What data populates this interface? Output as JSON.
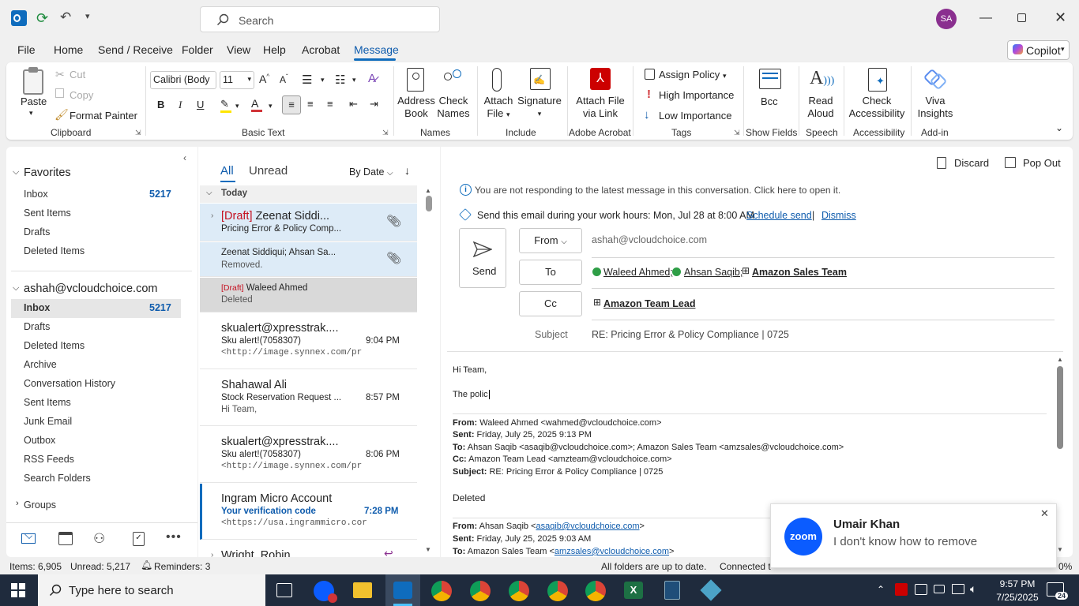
{
  "titlebar": {
    "search_placeholder": "Search",
    "avatar": "SA"
  },
  "menu": [
    "File",
    "Home",
    "Send / Receive",
    "Folder",
    "View",
    "Help",
    "Acrobat",
    "Message"
  ],
  "copilot": "Copilot",
  "ribbon": {
    "paste": "Paste",
    "cut": "Cut",
    "copy": "Copy",
    "format_painter": "Format Painter",
    "clipboard": "Clipboard",
    "font_name": "Calibri (Body",
    "font_size": "11",
    "basic_text": "Basic Text",
    "address_book": [
      "Address",
      "Book"
    ],
    "check_names": [
      "Check",
      "Names"
    ],
    "names": "Names",
    "attach_file": [
      "Attach",
      "File"
    ],
    "signature": "Signature",
    "include": "Include",
    "attach_link": [
      "Attach File",
      "via Link"
    ],
    "adobe": "Adobe Acrobat",
    "assign_policy": "Assign Policy",
    "high_importance": "High Importance",
    "low_importance": "Low Importance",
    "tags": "Tags",
    "bcc": "Bcc",
    "show_fields": "Show Fields",
    "read_aloud": [
      "Read",
      "Aloud"
    ],
    "speech": "Speech",
    "check_accessibility": [
      "Check",
      "Accessibility"
    ],
    "accessibility": "Accessibility",
    "viva": [
      "Viva",
      "Insights"
    ],
    "addin": "Add-in"
  },
  "folders": {
    "favorites": "Favorites",
    "fav_items": [
      {
        "label": "Inbox",
        "count": "5217"
      },
      {
        "label": "Sent Items"
      },
      {
        "label": "Drafts"
      },
      {
        "label": "Deleted Items"
      }
    ],
    "account": "ashah@vcloudchoice.com",
    "acct_items": [
      {
        "label": "Inbox",
        "count": "5217"
      },
      {
        "label": "Drafts"
      },
      {
        "label": "Deleted Items"
      },
      {
        "label": "Archive"
      },
      {
        "label": "Conversation History"
      },
      {
        "label": "Sent Items"
      },
      {
        "label": "Junk Email"
      },
      {
        "label": "Outbox"
      },
      {
        "label": "RSS Feeds"
      },
      {
        "label": "Search Folders"
      }
    ],
    "groups": "Groups"
  },
  "list": {
    "tab_all": "All",
    "tab_unread": "Unread",
    "sort": "By Date",
    "today": "Today",
    "draft_tag": "[Draft]",
    "items": [
      {
        "from": "Zeenat Siddi...",
        "subject": "Pricing Error & Policy Comp..."
      },
      {
        "from": "Zeenat Siddiqui;  Ahsan Sa...",
        "subject": "Removed."
      },
      {
        "from": "Waleed Ahmed",
        "subject": "Deleted"
      },
      {
        "from": "skualert@xpresstrak....",
        "subject": "Sku alert!(7058307)",
        "preview": "<http://image.synnex.com/pr",
        "time": "9:04 PM"
      },
      {
        "from": "Shahawal Ali",
        "subject": "Stock Reservation Request ...",
        "preview": "Hi Team,",
        "time": "8:57 PM"
      },
      {
        "from": "skualert@xpresstrak....",
        "subject": "Sku alert!(7058307)",
        "preview": "<http://image.synnex.com/pr",
        "time": "8:06 PM"
      },
      {
        "from": "Ingram Micro Account",
        "subject": "Your verification code",
        "preview": "<https://usa.ingrammicro.cor",
        "time": "7:28 PM"
      },
      {
        "from": "Wright, Robin"
      }
    ]
  },
  "reading": {
    "discard": "Discard",
    "popout": "Pop Out",
    "info": "You are not responding to the latest message in this conversation. Click here to open it.",
    "schedule_text": "Send this email during your work hours: Mon, Jul 28 at 8:00 AM",
    "schedule_send": "Schedule send",
    "sep": "|",
    "dismiss": "Dismiss",
    "send": "Send",
    "from_btn": "From",
    "from_value": "ashah@vcloudchoice.com",
    "to_btn": "To",
    "to": [
      "Waleed Ahmed;",
      "Ahsan Saqib;",
      "Amazon Sales Team"
    ],
    "cc_btn": "Cc",
    "cc": "Amazon Team Lead",
    "subject_label": "Subject",
    "subject": "RE: Pricing Error & Policy Compliance | 0725",
    "body_greeting": "Hi Team,",
    "body_line": "The polic",
    "q1": {
      "from_l": "From:",
      "from": " Waleed Ahmed <wahmed@vcloudchoice.com>",
      "sent_l": "Sent:",
      "sent": " Friday, July 25, 2025 9:13 PM",
      "to_l": "To:",
      "to": " Ahsan Saqib <asaqib@vcloudchoice.com>; Amazon Sales Team <amzsales@vcloudchoice.com>",
      "cc_l": "Cc:",
      "cc": " Amazon Team Lead <amzteam@vcloudchoice.com>",
      "subj_l": "Subject:",
      "subj": " RE: Pricing Error & Policy Compliance | 0725",
      "body": "Deleted"
    },
    "q2": {
      "from_l": "From:",
      "from": " Ahsan Saqib <",
      "from_link": "asaqib@vcloudchoice.com",
      "from_end": ">",
      "sent_l": "Sent:",
      "sent": " Friday, July 25, 2025 9:03 AM",
      "to_l": "To:",
      "to": " Amazon Sales Team <",
      "to_link": "amzsales@vcloudchoice.com",
      "to_end": ">"
    }
  },
  "toast": {
    "name": "Umair Khan",
    "message": "I don't know how to remove",
    "app": "zoom"
  },
  "status": {
    "items": "Items: 6,905",
    "unread": "Unread: 5,217",
    "reminders": "Reminders: 3",
    "sync": "All folders are up to date.",
    "connected": "Connected t",
    "zoom": "0%"
  },
  "taskbar": {
    "search": "Type here to search",
    "time": "9:57 PM",
    "date": "7/25/2025",
    "notif": "24"
  },
  "colors": {
    "accent": "#0f6cbd",
    "draft": "#c50f1f",
    "taskbar": "#1f2b3d"
  }
}
